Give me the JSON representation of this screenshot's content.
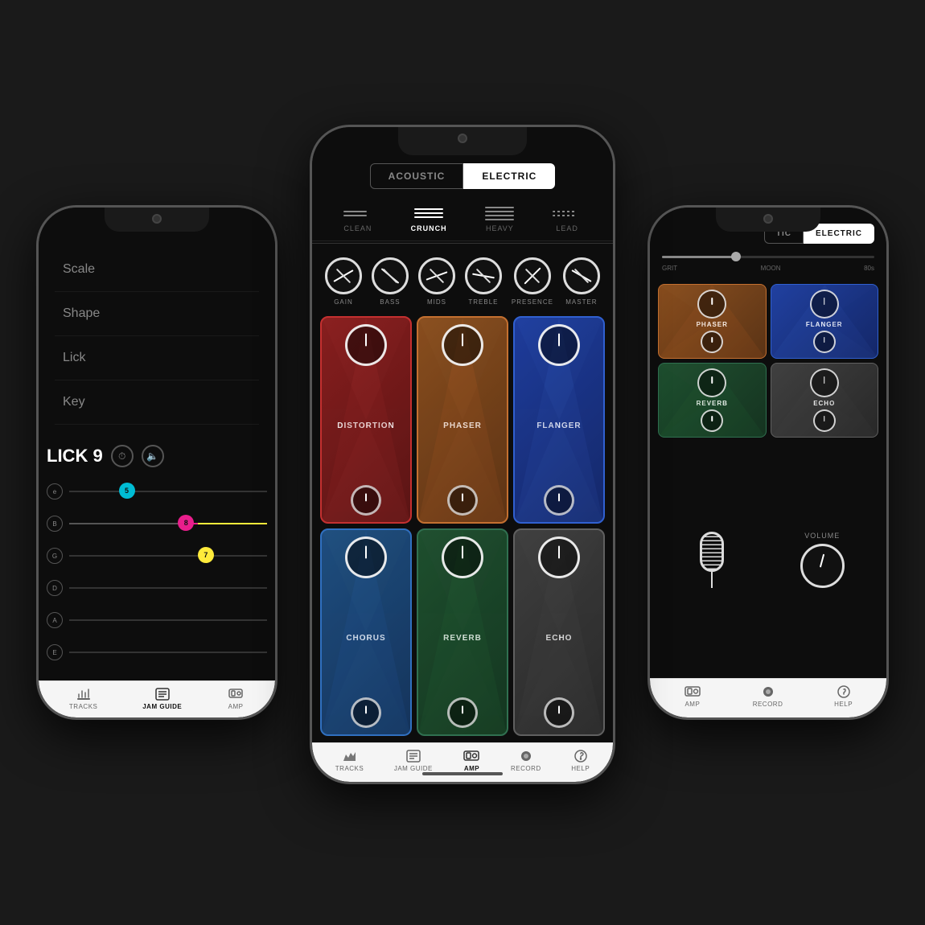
{
  "scene": {
    "bg_color": "#1a1a1a"
  },
  "left_phone": {
    "menu_items": [
      {
        "label": "Scale"
      },
      {
        "label": "Shape"
      },
      {
        "label": "Lick"
      },
      {
        "label": "Key"
      }
    ],
    "lick_title": "LICK 9",
    "strings": [
      {
        "label": "e",
        "note": "5",
        "color": "#00bcd4",
        "position": 25
      },
      {
        "label": "B",
        "note": "8",
        "color": "#e91e8c",
        "position": 55
      },
      {
        "label": "G",
        "note": "7",
        "color": "#ffeb3b",
        "position": 70
      },
      {
        "label": "D",
        "color": null,
        "position": null
      },
      {
        "label": "A",
        "color": null,
        "position": null
      },
      {
        "label": "E",
        "color": null,
        "position": null
      }
    ],
    "bottom_nav": [
      {
        "label": "TRACKS",
        "active": false
      },
      {
        "label": "JAM GUIDE",
        "active": true
      },
      {
        "label": "AMP",
        "active": false
      }
    ]
  },
  "center_phone": {
    "amp_types": [
      {
        "label": "ACOUSTIC",
        "active": false
      },
      {
        "label": "ELECTRIC",
        "active": true
      }
    ],
    "channels": [
      {
        "label": "CLEAN",
        "active": false
      },
      {
        "label": "CRUNCH",
        "active": true
      },
      {
        "label": "HEAVY",
        "active": false
      },
      {
        "label": "LEAD",
        "active": false
      }
    ],
    "knobs": [
      {
        "label": "GAIN"
      },
      {
        "label": "BASS"
      },
      {
        "label": "MIDS"
      },
      {
        "label": "TREBLE"
      },
      {
        "label": "PRESENCE"
      },
      {
        "label": "MASTER"
      }
    ],
    "fx": [
      {
        "name": "DISTORTION",
        "color_class": "fx-distortion"
      },
      {
        "name": "PHASER",
        "color_class": "fx-phaser"
      },
      {
        "name": "FLANGER",
        "color_class": "fx-flanger"
      },
      {
        "name": "CHORUS",
        "color_class": "fx-chorus"
      },
      {
        "name": "REVERB",
        "color_class": "fx-reverb"
      },
      {
        "name": "ECHO",
        "color_class": "fx-echo"
      }
    ],
    "bottom_nav": [
      {
        "label": "TRACKS",
        "active": false
      },
      {
        "label": "JAM GUIDE",
        "active": false
      },
      {
        "label": "AMP",
        "active": true
      },
      {
        "label": "RECORD",
        "active": false
      },
      {
        "label": "HELP",
        "active": false
      }
    ]
  },
  "right_phone": {
    "amp_types": [
      {
        "label": "TIC",
        "active": false
      },
      {
        "label": "ELECTRIC",
        "active": true
      }
    ],
    "slider_labels": [
      "GRIT",
      "MOON",
      "80s"
    ],
    "fx_cells": [
      {
        "name": "PHASER",
        "color": "#8B5020"
      },
      {
        "name": "FLANGER",
        "color": "#2040a0"
      },
      {
        "name": "REVERB",
        "color": "#205030"
      },
      {
        "name": "ECHO",
        "color": "#404040"
      }
    ],
    "volume_label": "VOLUME",
    "bottom_nav": [
      {
        "label": "AMP",
        "active": false
      },
      {
        "label": "RECORD",
        "active": false
      },
      {
        "label": "HELP",
        "active": false
      }
    ]
  }
}
